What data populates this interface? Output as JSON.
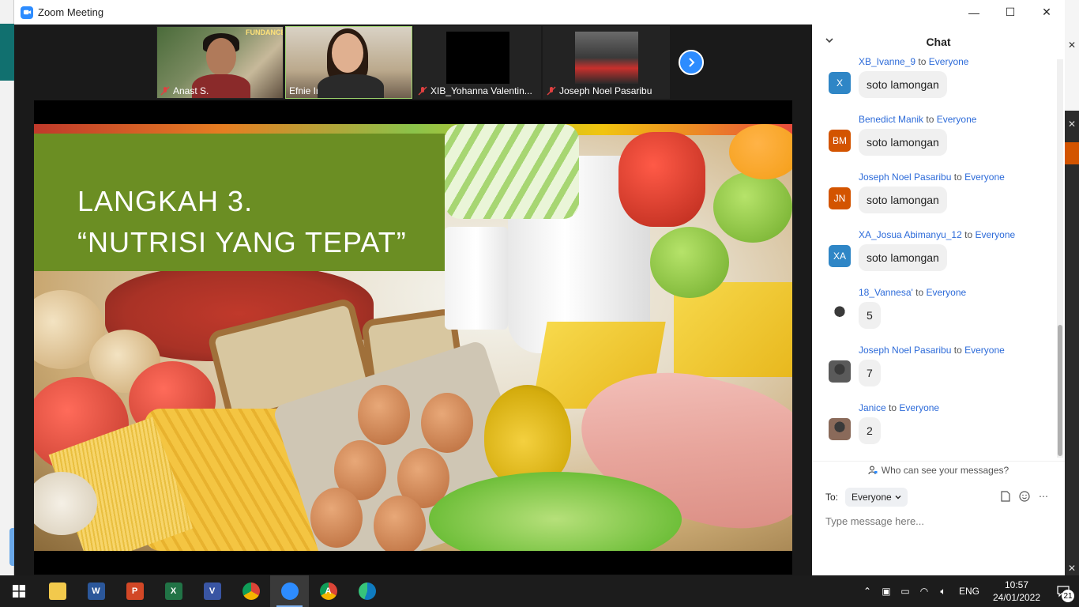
{
  "window": {
    "title": "Zoom Meeting",
    "minimize": "—",
    "maximize": "☐",
    "close": "✕"
  },
  "participants": [
    {
      "name": "Anast S.",
      "banner": "FUNDANCE"
    },
    {
      "name": "Efnie Indrianie"
    },
    {
      "name": "XIB_Yohanna Valentin..."
    },
    {
      "name": "Joseph Noel Pasaribu"
    }
  ],
  "slide": {
    "line1": "LANGKAH 3.",
    "line2": "“NUTRISI YANG TEPAT”"
  },
  "chat": {
    "title": "Chat",
    "to_word": "to",
    "messages": [
      {
        "sender": "XB_Ivanne_9",
        "recipient": "Everyone",
        "initials": "X",
        "avatar_color": "#2f86c6",
        "text": "soto lamongan"
      },
      {
        "sender": "Benedict Manik",
        "recipient": "Everyone",
        "initials": "BM",
        "avatar_color": "#d35400",
        "text": "soto lamongan"
      },
      {
        "sender": "Joseph Noel Pasaribu",
        "recipient": "Everyone",
        "initials": "JN",
        "avatar_color": "#d35400",
        "text": "soto lamongan"
      },
      {
        "sender": "XA_Josua Abimanyu_12",
        "recipient": "Everyone",
        "initials": "XA",
        "avatar_color": "#2f86c6",
        "text": "soto lamongan"
      },
      {
        "sender": "18_Vannesa'",
        "recipient": "Everyone",
        "initials": "",
        "avatar_color": "#ffffff",
        "text": "5"
      },
      {
        "sender": "Joseph Noel Pasaribu",
        "recipient": "Everyone",
        "initials": "",
        "avatar_color": "#5a5a5a",
        "text": "7"
      },
      {
        "sender": "Janice",
        "recipient": "Everyone",
        "initials": "",
        "avatar_color": "#8a6a5a",
        "text": "2"
      }
    ],
    "who_can_see": "Who can see your messages?",
    "to_label": "To:",
    "to_value": "Everyone",
    "input_placeholder": "Type message here..."
  },
  "taskbar": {
    "apps": [
      {
        "name": "file-explorer",
        "label": "",
        "color": "#f2c94c"
      },
      {
        "name": "word",
        "label": "W",
        "color": "#2b579a"
      },
      {
        "name": "powerpoint",
        "label": "P",
        "color": "#d24726"
      },
      {
        "name": "excel",
        "label": "X",
        "color": "#217346"
      },
      {
        "name": "visio",
        "label": "V",
        "color": "#3955a3"
      },
      {
        "name": "chrome",
        "label": "",
        "color": "#4285f4"
      },
      {
        "name": "zoom",
        "label": "",
        "color": "#2d8cff"
      },
      {
        "name": "chrome-profile",
        "label": "A",
        "color": "#4285f4"
      },
      {
        "name": "edge",
        "label": "",
        "color": "#0f7bbf"
      }
    ],
    "lang": "ENG",
    "time": "10:57",
    "date": "24/01/2022",
    "notifications": "21"
  }
}
